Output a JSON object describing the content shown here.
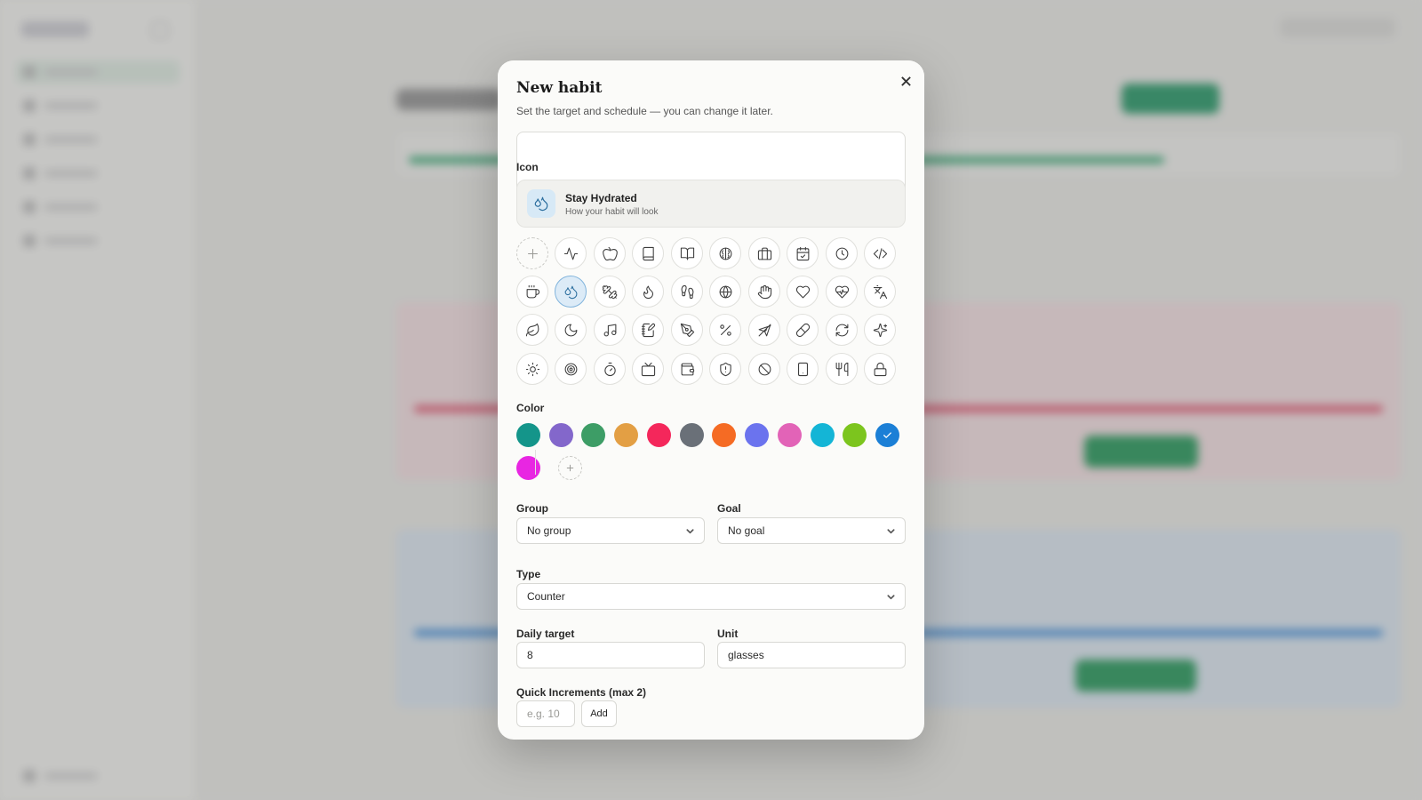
{
  "modal": {
    "title": "New habit",
    "subtitle": "Set the target and schedule — you can change it later.",
    "close_icon": "close-icon"
  },
  "icon_section": {
    "label": "Icon",
    "preview": {
      "name": "Stay Hydrated",
      "hint": "How your habit will look",
      "icon": "droplets-icon"
    },
    "selected": "droplets-icon",
    "rows": [
      [
        "add-icon",
        "activity-icon",
        "apple-icon",
        "book-icon",
        "book-open-icon",
        "brain-icon",
        "briefcase-icon",
        "calendar-check-icon",
        "clock-icon",
        "code-icon"
      ],
      [
        "coffee-icon",
        "droplets-icon",
        "dumbbell-icon",
        "flame-icon",
        "footprints-icon",
        "globe-icon",
        "hand-icon",
        "heart-icon",
        "heart-pulse-icon",
        "languages-icon"
      ],
      [
        "leaf-icon",
        "moon-icon",
        "music-icon",
        "notebook-pen-icon",
        "pen-tool-icon",
        "percent-icon",
        "plane-icon",
        "pill-icon",
        "refresh-icon",
        "sparkles-icon"
      ],
      [
        "sun-icon",
        "target-icon",
        "timer-icon",
        "tv-icon",
        "wallet-icon",
        "shield-icon",
        "ban-icon",
        "smartphone-icon",
        "utensils-icon",
        "lock-icon"
      ]
    ]
  },
  "color_section": {
    "label": "Color",
    "colors": [
      "#14958a",
      "#8367cb",
      "#3d9d66",
      "#e39f44",
      "#f4275b",
      "#6a7078",
      "#f56b24",
      "#6b73ee",
      "#e263b7",
      "#14b5d6",
      "#7cc51e",
      "#1b7fd6",
      "#e826e2"
    ],
    "selected": "#1b7fd6",
    "add_icon": "plus-icon"
  },
  "group": {
    "label": "Group",
    "value": "No group"
  },
  "goal": {
    "label": "Goal",
    "value": "No goal"
  },
  "type": {
    "label": "Type",
    "value": "Counter"
  },
  "daily_target": {
    "label": "Daily target",
    "value": "8"
  },
  "unit": {
    "label": "Unit",
    "value": "glasses"
  },
  "quick_increments": {
    "label": "Quick Increments (max 2)",
    "placeholder": "e.g. 10",
    "add_label": "Add"
  }
}
